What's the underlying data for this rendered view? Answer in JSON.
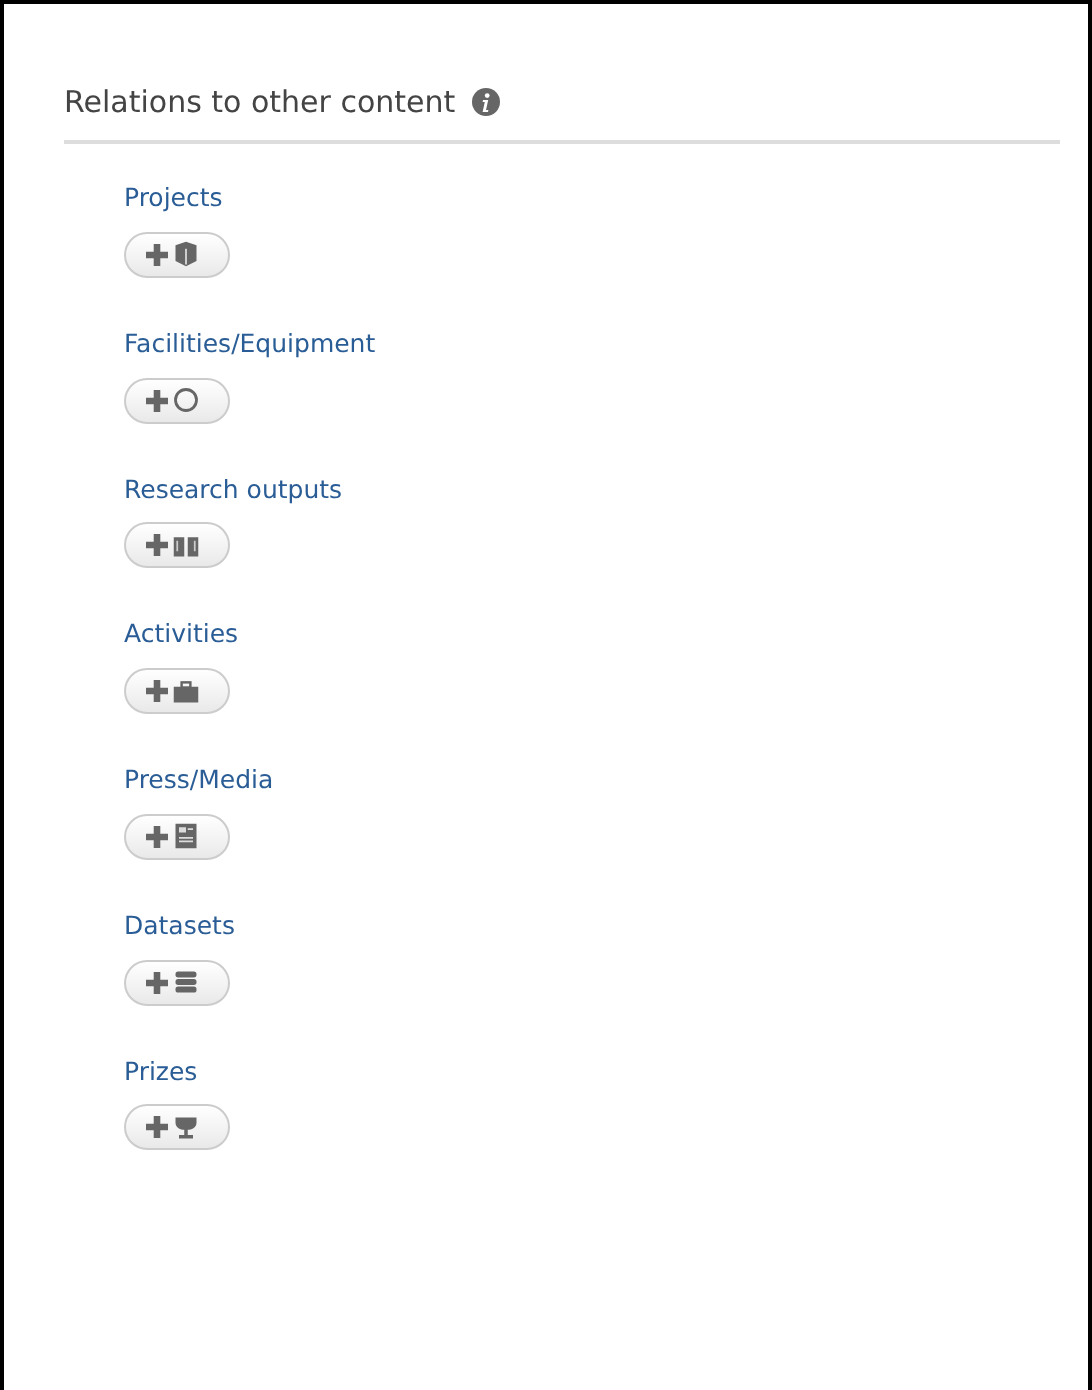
{
  "section": {
    "title": "Relations to other content"
  },
  "relations": [
    {
      "label": "Projects",
      "kind": "cube"
    },
    {
      "label": "Facilities/Equipment",
      "kind": "circle"
    },
    {
      "label": "Research outputs",
      "kind": "book"
    },
    {
      "label": "Activities",
      "kind": "briefcase"
    },
    {
      "label": "Press/Media",
      "kind": "newspaper"
    },
    {
      "label": "Datasets",
      "kind": "database"
    },
    {
      "label": "Prizes",
      "kind": "trophy"
    }
  ]
}
